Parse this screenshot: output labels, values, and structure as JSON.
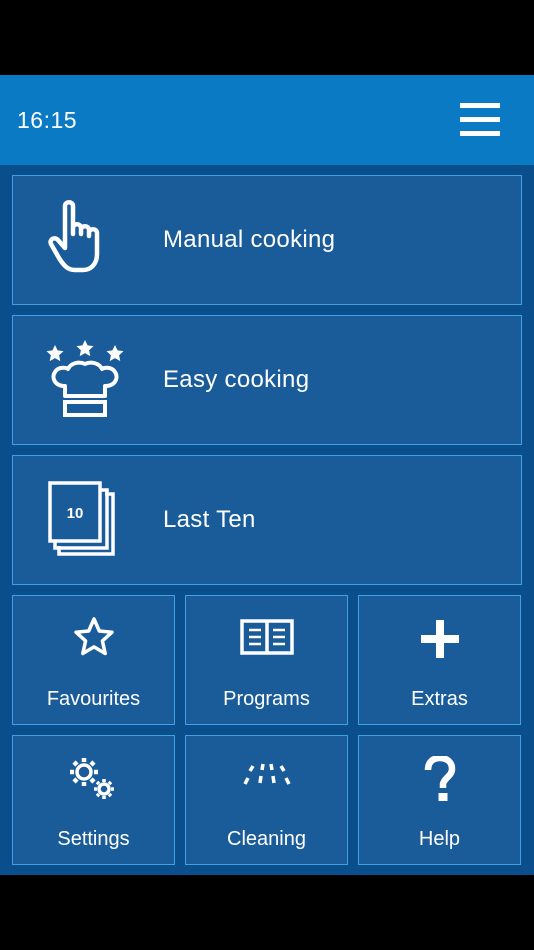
{
  "header": {
    "time": "16:15",
    "menu_icon": "hamburger-menu-icon"
  },
  "main_tiles": [
    {
      "label": "Manual cooking",
      "icon": "hand-pointer-icon"
    },
    {
      "label": "Easy cooking",
      "icon": "chef-hat-stars-icon"
    },
    {
      "label": "Last Ten",
      "icon": "last-ten-stack-icon",
      "icon_text": "10"
    }
  ],
  "grid_tiles": [
    {
      "label": "Favourites",
      "icon": "star-icon"
    },
    {
      "label": "Programs",
      "icon": "book-icon"
    },
    {
      "label": "Extras",
      "icon": "plus-icon"
    },
    {
      "label": "Settings",
      "icon": "gears-icon"
    },
    {
      "label": "Cleaning",
      "icon": "spray-icon"
    },
    {
      "label": "Help",
      "icon": "question-mark-icon"
    }
  ],
  "colors": {
    "header": "#0a7ac4",
    "background": "#0b4e8c",
    "tile": "#1a5c99",
    "tile_border": "#3fa0e4"
  }
}
